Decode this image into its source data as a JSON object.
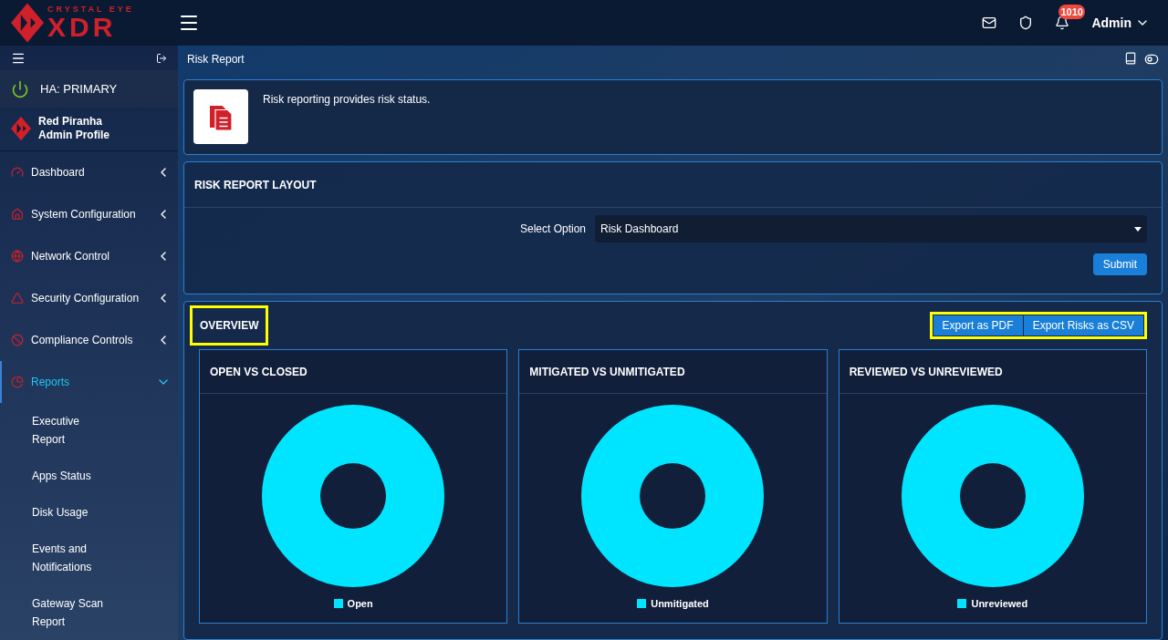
{
  "brand": {
    "tagline": "CRYSTAL EYE",
    "name": "XDR"
  },
  "topbar": {
    "notifications": "1010",
    "user": "Admin"
  },
  "sidebar": {
    "ha_status": "HA: PRIMARY",
    "profile": {
      "name": "Red Piranha",
      "role": "Admin Profile"
    },
    "items": [
      {
        "label": "Dashboard",
        "selected": false,
        "expanded": false
      },
      {
        "label": "System Configuration",
        "selected": false,
        "expanded": false
      },
      {
        "label": "Network Control",
        "selected": false,
        "expanded": false
      },
      {
        "label": "Security Configuration",
        "selected": false,
        "expanded": false
      },
      {
        "label": "Compliance Controls",
        "selected": false,
        "expanded": false
      },
      {
        "label": "Reports",
        "selected": true,
        "expanded": true,
        "children": [
          {
            "label": "Executive Report"
          },
          {
            "label": "Apps Status"
          },
          {
            "label": "Disk Usage"
          },
          {
            "label": "Events and Notifications"
          },
          {
            "label": "Gateway Scan Report"
          }
        ]
      }
    ]
  },
  "page": {
    "title": "Risk Report",
    "description": "Risk reporting provides risk status."
  },
  "layout_panel": {
    "title": "RISK REPORT LAYOUT",
    "select_label": "Select Option",
    "select_value": "Risk Dashboard",
    "submit": "Submit"
  },
  "overview": {
    "title": "OVERVIEW",
    "highlighted": true,
    "buttons_highlighted": true,
    "buttons": [
      "Export as PDF",
      "Export Risks as CSV"
    ],
    "charts": [
      {
        "title": "OPEN VS CLOSED",
        "legend": "Open"
      },
      {
        "title": "MITIGATED VS UNMITIGATED",
        "legend": "Unmitigated"
      },
      {
        "title": "REVIEWED VS UNREVIEWED",
        "legend": "Unreviewed"
      }
    ]
  }
}
